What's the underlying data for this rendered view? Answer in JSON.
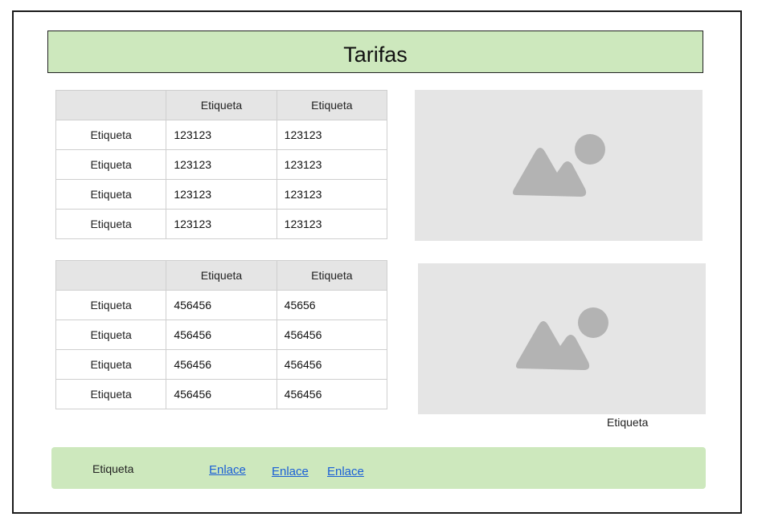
{
  "title": "Tarifas",
  "table1": {
    "headers": [
      "",
      "Etiqueta",
      "Etiqueta"
    ],
    "rows": [
      {
        "label": "Etiqueta",
        "c1": "123123",
        "c2": "123123"
      },
      {
        "label": "Etiqueta",
        "c1": "123123",
        "c2": "123123"
      },
      {
        "label": "Etiqueta",
        "c1": "123123",
        "c2": "123123"
      },
      {
        "label": "Etiqueta",
        "c1": "123123",
        "c2": "123123"
      }
    ]
  },
  "table2": {
    "headers": [
      "",
      "Etiqueta",
      "Etiqueta"
    ],
    "rows": [
      {
        "label": "Etiqueta",
        "c1": "456456",
        "c2": "45656"
      },
      {
        "label": "Etiqueta",
        "c1": "456456",
        "c2": "456456"
      },
      {
        "label": "Etiqueta",
        "c1": "456456",
        "c2": "456456"
      },
      {
        "label": "Etiqueta",
        "c1": "456456",
        "c2": "456456"
      }
    ]
  },
  "image2_caption": "Etiqueta",
  "footer": {
    "label": "Etiqueta",
    "links": [
      "Enlace",
      "Enlace",
      "Enlace"
    ]
  },
  "colors": {
    "title_bg": "#cde8bd",
    "footer_bg": "#cde8bd",
    "placeholder_bg": "#e5e5e5",
    "placeholder_icon": "#b3b3b3",
    "link": "#1a5fd6"
  },
  "icons": {
    "image1": "image-placeholder-icon",
    "image2": "image-placeholder-icon"
  }
}
